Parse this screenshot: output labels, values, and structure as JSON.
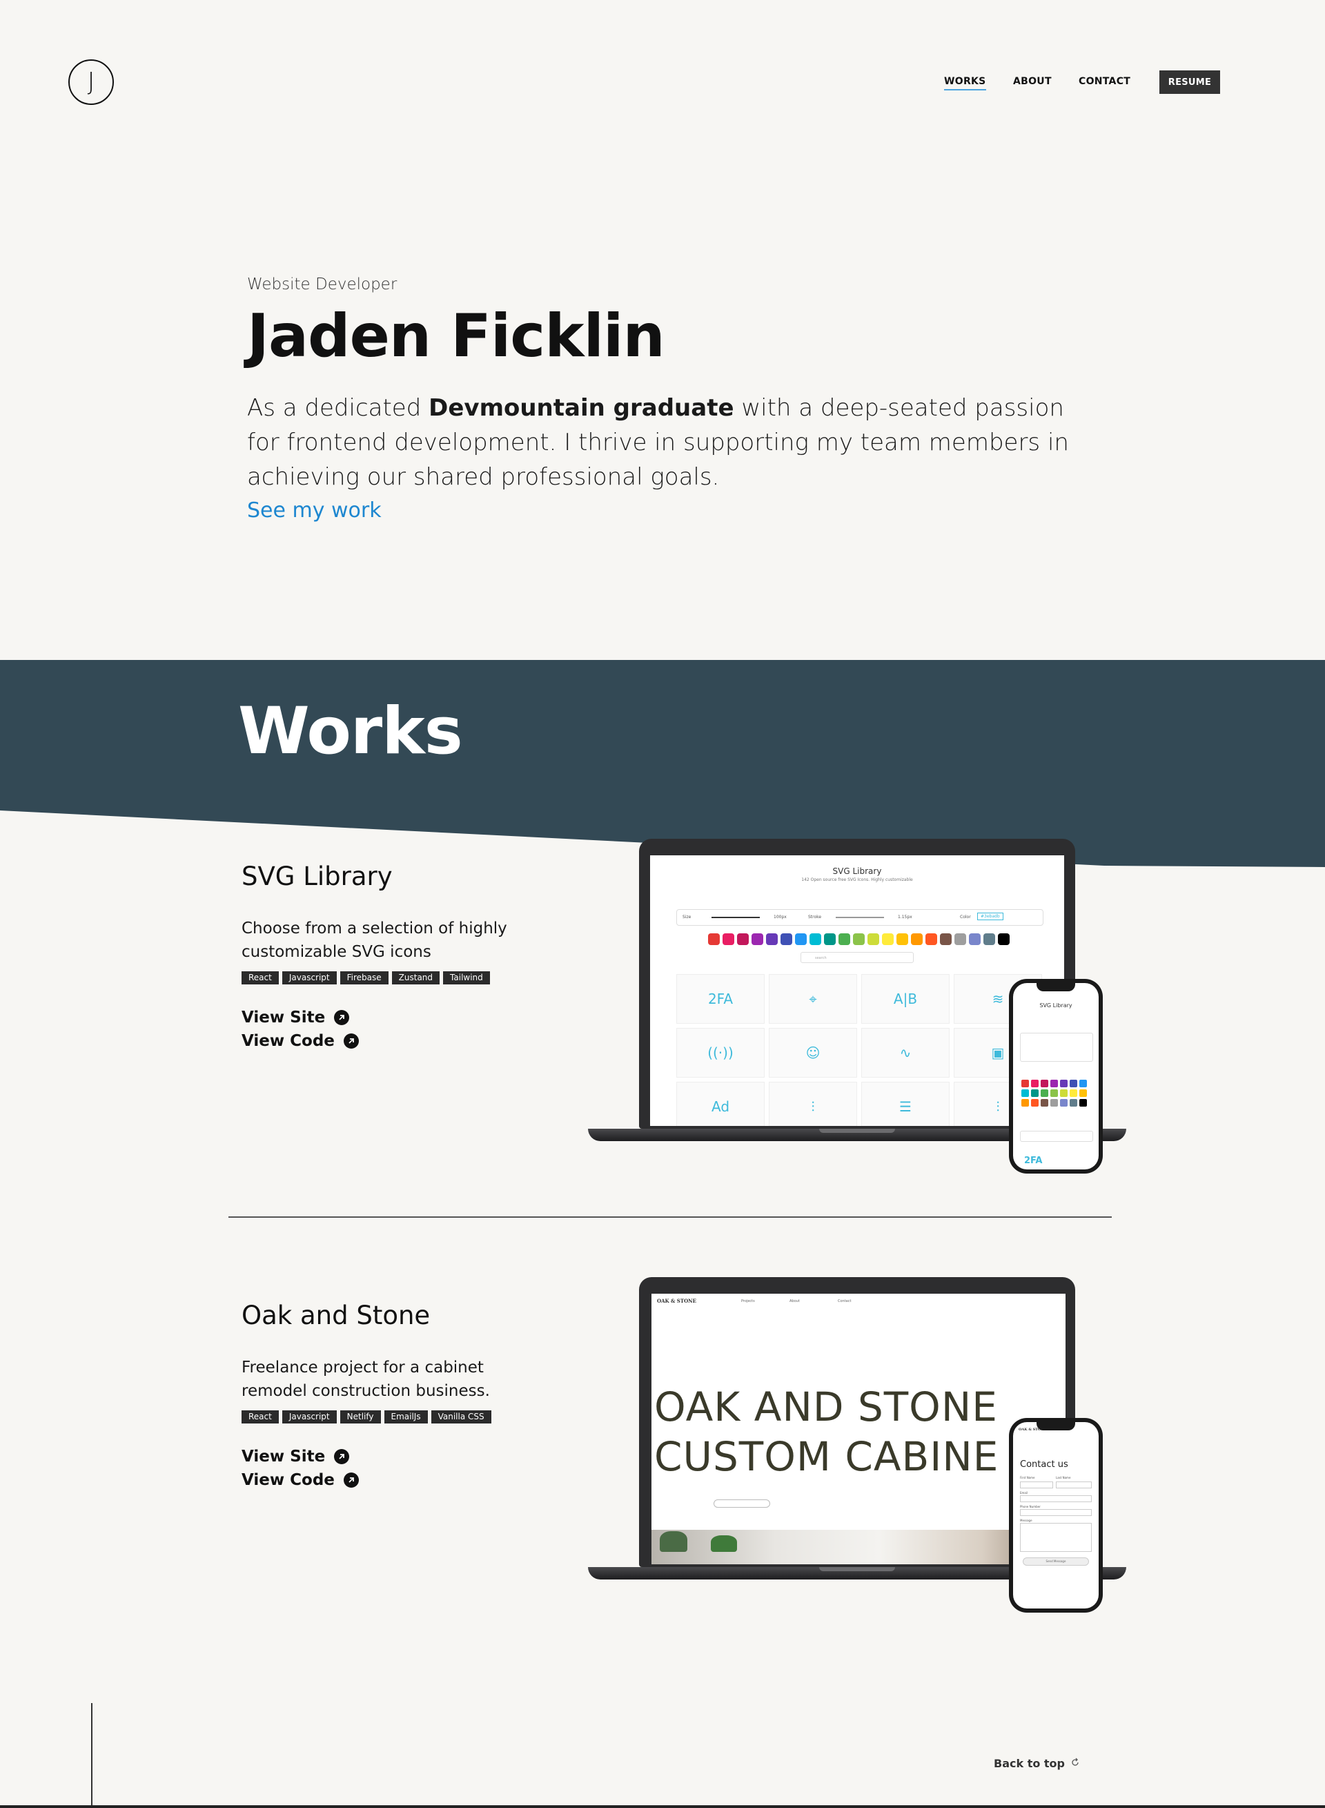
{
  "header": {
    "logo_letter": "J",
    "nav": {
      "works": "WORKS",
      "about": "ABOUT",
      "contact": "CONTACT"
    },
    "resume_label": "RESUME"
  },
  "hero": {
    "role": "Website Developer",
    "name": "Jaden Ficklin",
    "bio_pre": "As a dedicated ",
    "bio_bold": "Devmountain graduate",
    "bio_post": " with a deep-seated passion for frontend development. I thrive in supporting my team members in achieving our shared professional goals.",
    "cta": "See my work"
  },
  "works": {
    "title": "Works",
    "banner_color": "#334955",
    "projects": [
      {
        "title": "SVG Library",
        "description": "Choose from a selection of highly customizable SVG icons",
        "tags": [
          "React",
          "Javascript",
          "Firebase",
          "Zustand",
          "Tailwind"
        ],
        "view_site": "View Site",
        "view_code": "View Code",
        "preview": {
          "heading": "SVG Library",
          "subheading": "142 Open source free SVG Icons. Highly customizable",
          "size_label": "Size",
          "size_value": "100px",
          "stroke_label": "Stroke",
          "stroke_value": "1.15px",
          "color_label": "Color",
          "color_value": "#3ebadb",
          "search_placeholder": "search",
          "icon_glyphs": [
            "2FA",
            "⌖",
            "A|B",
            "≋",
            "((·))",
            "☺",
            "∿",
            "▣",
            "Ad",
            "⫶",
            "☰",
            "⫶"
          ],
          "swatches": [
            "#e53935",
            "#e91e63",
            "#c2185b",
            "#9c27b0",
            "#673ab7",
            "#3f51b5",
            "#2196f3",
            "#00bcd4",
            "#009688",
            "#4caf50",
            "#8bc34a",
            "#cddc39",
            "#ffeb3b",
            "#ffc107",
            "#ff9800",
            "#ff5722",
            "#795548",
            "#9e9e9e",
            "#7986cb",
            "#607d8b",
            "#000000"
          ]
        }
      },
      {
        "title": "Oak and Stone",
        "description": "Freelance project for a cabinet remodel construction business.",
        "tags": [
          "React",
          "Javascript",
          "Netlify",
          "EmailJs",
          "Vanilla CSS"
        ],
        "view_site": "View Site",
        "view_code": "View Code",
        "preview": {
          "brand": "OAK & STONE",
          "hero_line1": "OAK AND STONE",
          "hero_line2": "CUSTOM CABINE",
          "nav": [
            "Projects",
            "About",
            "Contact"
          ],
          "contact_title": "Contact us",
          "fields": [
            "First Name",
            "Last Name",
            "Email",
            "Phone Number",
            "Message"
          ],
          "send_label": "Send Message"
        }
      }
    ]
  },
  "footer": {
    "back_to_top": "Back to top"
  }
}
